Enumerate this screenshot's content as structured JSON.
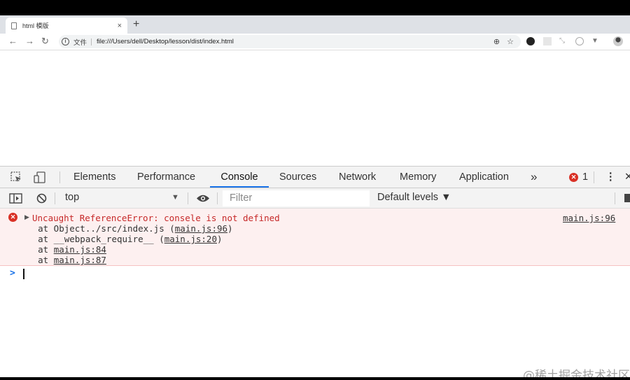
{
  "browser": {
    "tab_title": "html 模版",
    "tab_close": "×",
    "new_tab": "+",
    "security_label": "文件",
    "url": "file:///Users/dell/Desktop/lesson/dist/index.html"
  },
  "devtools": {
    "tabs": [
      "Elements",
      "Performance",
      "Console",
      "Sources",
      "Network",
      "Memory",
      "Application"
    ],
    "active_tab": "Console",
    "more_tabs": "»",
    "error_count": "1",
    "context": "top",
    "filter_placeholder": "Filter",
    "levels": "Default levels ▼"
  },
  "console": {
    "error_message": "Uncaught ReferenceError: consele is not defined",
    "error_source": "main.js:96",
    "stack": [
      {
        "prefix": "    at Object../src/index.js (",
        "link": "main.js:96",
        "suffix": ")"
      },
      {
        "prefix": "    at __webpack_require__ (",
        "link": "main.js:20",
        "suffix": ")"
      },
      {
        "prefix": "    at ",
        "link": "main.js:84",
        "suffix": ""
      },
      {
        "prefix": "    at ",
        "link": "main.js:87",
        "suffix": ""
      }
    ],
    "prompt": ">"
  },
  "watermark": "@稀土掘金技术社区",
  "colors": {
    "error": "#d93025",
    "accent": "#1a73e8",
    "error_bg": "#fdf0f0"
  }
}
